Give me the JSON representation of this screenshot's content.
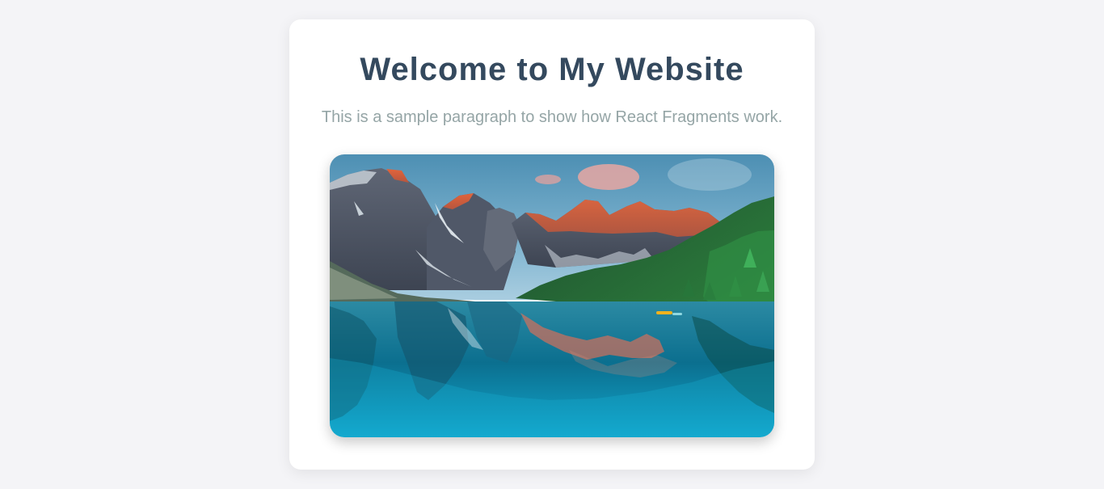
{
  "page": {
    "title": "Welcome to My Website",
    "subtitle": "This is a sample paragraph to show how React Fragments work."
  },
  "image": {
    "subject": "mountain lake landscape",
    "icon": "landscape-image"
  },
  "colors": {
    "background": "#f4f4f7",
    "card": "#ffffff",
    "title": "#34495e",
    "subtitle": "#95a5a6"
  }
}
